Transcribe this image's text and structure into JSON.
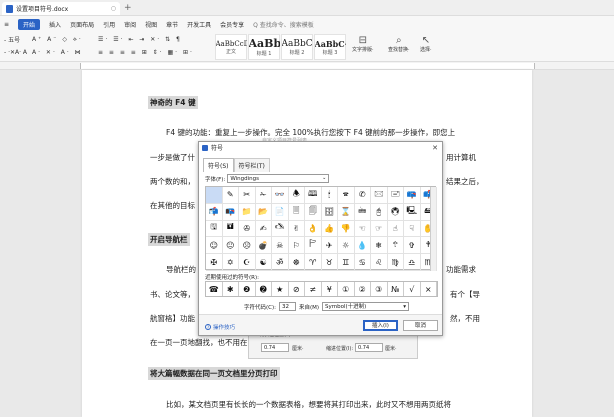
{
  "titlebar": {
    "doc_name": "设置项目符号.docx",
    "close": "○",
    "add": "+"
  },
  "ribbon": {
    "menu": "≡",
    "tabs": [
      "开始",
      "插入",
      "页面布局",
      "引用",
      "审阅",
      "视图",
      "章节",
      "开发工具",
      "会员专享"
    ],
    "search": "Q 查找命令、搜索模板"
  },
  "toolbar": {
    "font": "- 五号",
    "size": "- ·✕A· A",
    "fmt_row1": "A⁺ A⁻ ◇ ⟡·",
    "fmt_row2": "A· ✕· A· ⋈",
    "list_row1": "☰· ☰· ⇤ ⇥ ✕· ⇅ ¶",
    "list_row2": "≡ ≡ ≡ ≡ ⊞ ⇕· ▦· ⊞·",
    "styles": [
      {
        "preview": "AaBbCcDd",
        "label": "正文"
      },
      {
        "preview": "AaBb",
        "label": "标题 1"
      },
      {
        "preview": "AaBbC",
        "label": "标题 2"
      },
      {
        "preview": "AaBbC·",
        "label": "标题 3"
      }
    ],
    "text_tool": "文字排版·",
    "find_tool": "查找替换·",
    "select_tool": "选择·"
  },
  "document": {
    "h1": "神奇的 F4 键",
    "p1": "F4 键的功能：重复上一步操作。完全 100%执行您按下 F4 键前的那一步操作，即您上",
    "p2_left": "一步是做了什",
    "p2_right": "用计算机",
    "p3_left": "两个数的和，",
    "p3_right": "结果之后，",
    "p4_left": "在其他的目标",
    "h2": "开启导航栏",
    "p5_left": "导航栏的",
    "p5_right": "功能需求",
    "p6_left": "书、论文等，",
    "p6_right": "有个【导",
    "p7_left": "航窗格】功能",
    "p7_right": "然，不用",
    "p8": "在一页一页地翻找，也不用在",
    "h3": "将大篇幅数据在同一页文档里分页打印",
    "p9": "比如，某文档页里有长长的一个数据表格，想要将其打印出来，此时又不想用两页纸将"
  },
  "bg_dialog": {
    "label_a": "制表位位置(F):",
    "val_a": "0.74",
    "unit_a": "厘米·",
    "label_b": "缩进位置(I):",
    "val_b": "0.74",
    "unit_b": "厘米·"
  },
  "dialog": {
    "title": "符号",
    "close": "✕",
    "ghost": "自定义项目符号列表",
    "tabs": [
      "符号(S)",
      "符号栏(T)"
    ],
    "font_label": "字体(F):",
    "font_value": "Wingdings",
    "font_arrow": "⌄",
    "symbols": [
      "",
      "✎",
      "✂",
      "✁",
      "👓",
      "🕭",
      "🕮",
      "🕯",
      "🕿",
      "✆",
      "🖂",
      "🖃",
      "📪",
      "📫",
      "📬",
      "📭",
      "📁",
      "📂",
      "📄",
      "🗏",
      "🗐",
      "🗄",
      "⌛",
      "🖮",
      "🖰",
      "🖲",
      "🖳",
      "🖴",
      "🖫",
      "🖬",
      "✇",
      "✍",
      "🖎",
      "✌",
      "👌",
      "👍",
      "👎",
      "☜",
      "☞",
      "☝",
      "☟",
      "✋",
      "☺",
      "😐",
      "☹",
      "💣",
      "☠",
      "⚐",
      "🏱",
      "✈",
      "☼",
      "💧",
      "❄",
      "🕆",
      "✞",
      "🕈",
      "✠",
      "✡",
      "☪",
      "☯",
      "ॐ",
      "☸",
      "♈",
      "♉",
      "♊",
      "♋",
      "♌",
      "♍",
      "♎",
      "♏"
    ],
    "recent_label": "近期使用过的符号(R):",
    "recent": [
      "☎",
      "✱",
      "❷",
      "➋",
      "★",
      "⊘",
      "≠",
      "¥",
      "①",
      "②",
      "③",
      "№",
      "√",
      "×"
    ],
    "code_label": "字符代码(C):",
    "code_value": "32",
    "from_label": "来自(M)",
    "from_value": "Symbol(十进制)",
    "from_arrow": "▾",
    "tips": "操作技巧",
    "tips_icon": "?",
    "insert": "插入(I)",
    "cancel": "取消"
  }
}
